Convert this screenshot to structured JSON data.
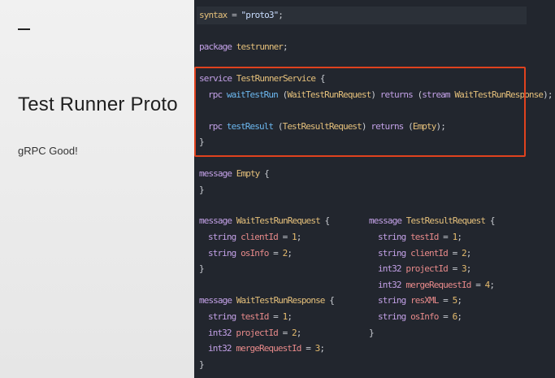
{
  "slide": {
    "title": "Test Runner Proto",
    "subtitle": "gRPC Good!"
  },
  "code": {
    "l1": [
      "syntax",
      " = ",
      "\"proto3\"",
      ";"
    ],
    "l2": [
      "package",
      " ",
      "testrunner",
      ";"
    ],
    "l3": [
      "service",
      " ",
      "TestRunnerService",
      " {"
    ],
    "l4": [
      "rpc",
      " ",
      "waitTestRun",
      " (",
      "WaitTestRunRequest",
      ") ",
      "returns",
      " (",
      "stream",
      " ",
      "WaitTestRunResponse",
      ");"
    ],
    "l5": [
      "rpc",
      " ",
      "testResult",
      " (",
      "TestResultRequest",
      ") ",
      "returns",
      " (",
      "Empty",
      ");"
    ],
    "l6": [
      "}"
    ],
    "l7": [
      "message",
      " ",
      "Empty",
      " {"
    ],
    "l8": [
      "}"
    ],
    "l9": [
      "message",
      " ",
      "WaitTestRunRequest",
      " {"
    ],
    "l10": [
      "string",
      " ",
      "clientId",
      " = ",
      "1",
      ";"
    ],
    "l11": [
      "string",
      " ",
      "osInfo",
      " = ",
      "2",
      ";"
    ],
    "l12": [
      "}"
    ],
    "l13": [
      "message",
      " ",
      "WaitTestRunResponse",
      " {"
    ],
    "l14": [
      "string",
      " ",
      "testId",
      " = ",
      "1",
      ";"
    ],
    "l15": [
      "int32",
      " ",
      "projectId",
      " = ",
      "2",
      ";"
    ],
    "l16": [
      "int32",
      " ",
      "mergeRequestId",
      " = ",
      "3",
      ";"
    ],
    "l17": [
      "}"
    ],
    "r1": [
      "message",
      " ",
      "TestResultRequest",
      " {"
    ],
    "r2": [
      "string",
      " ",
      "testId",
      " = ",
      "1",
      ";"
    ],
    "r3": [
      "string",
      " ",
      "clientId",
      " = ",
      "2",
      ";"
    ],
    "r4": [
      "int32",
      " ",
      "projectId",
      " = ",
      "3",
      ";"
    ],
    "r5": [
      "int32",
      " ",
      "mergeRequestId",
      " = ",
      "4",
      ";"
    ],
    "r6": [
      "string",
      " ",
      "resXML",
      " = ",
      "5",
      ";"
    ],
    "r7": [
      "string",
      " ",
      "osInfo",
      " = ",
      "6",
      ";"
    ],
    "r8": [
      "}"
    ]
  },
  "colors": {
    "highlight_border": "#e0421e",
    "editor_background": "#22262e"
  }
}
